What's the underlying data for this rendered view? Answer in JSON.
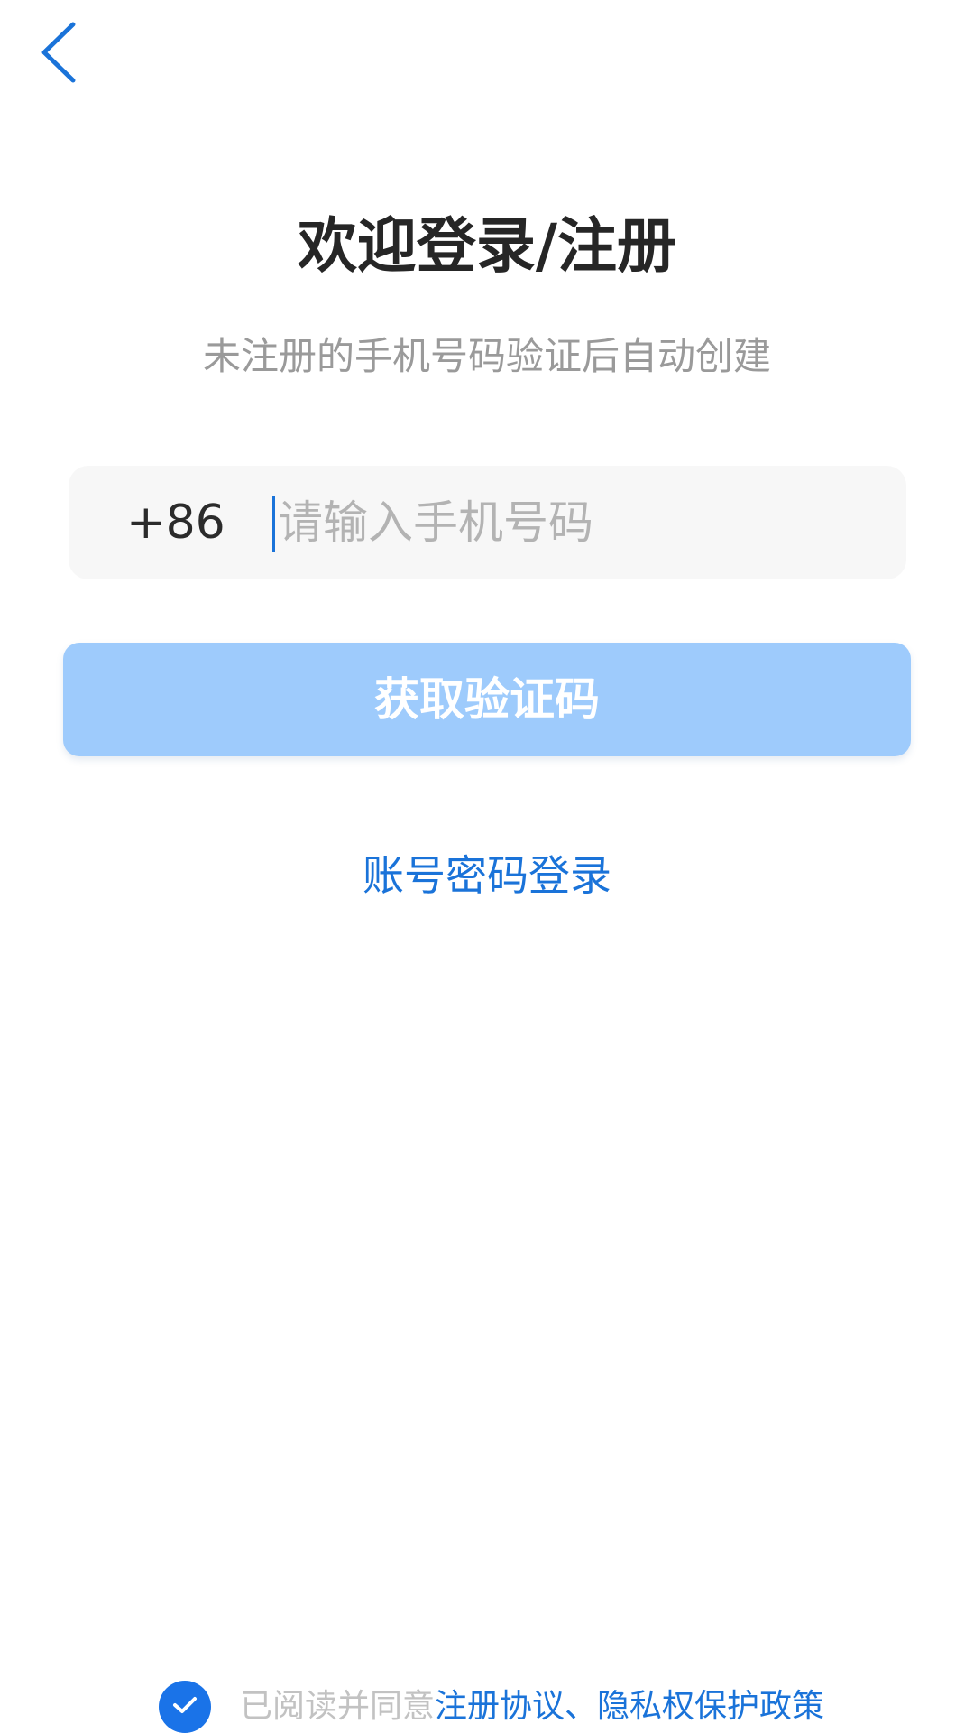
{
  "header": {
    "back_icon": "chevron-left-icon"
  },
  "main": {
    "title": "欢迎登录/注册",
    "subtitle": "未注册的手机号码验证后自动创建",
    "phone": {
      "country_code": "+86",
      "placeholder": "请输入手机号码",
      "value": ""
    },
    "get_code_label": "获取验证码",
    "password_login_label": "账号密码登录"
  },
  "agreement": {
    "checked": true,
    "check_icon": "check-icon",
    "prefix": "已阅读并同意",
    "terms_label": "注册协议",
    "separator": "、",
    "privacy_label": "隐私权保护政策"
  },
  "colors": {
    "accent": "#1a73d9",
    "button_disabled": "#9ecbfc",
    "title": "#262626",
    "subtitle": "#9a9a9a",
    "input_bg": "#f7f7f7"
  }
}
